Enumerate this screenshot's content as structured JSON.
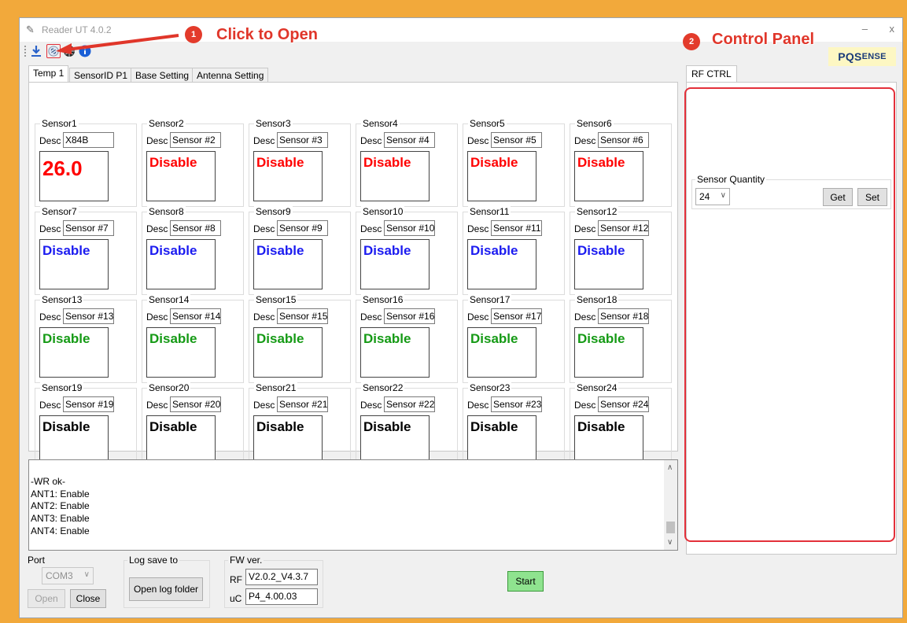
{
  "window": {
    "title": "Reader UT 4.0.2",
    "minimize": "–",
    "close": "x"
  },
  "brand": {
    "first": "PQS",
    "rest": "ENSE"
  },
  "callouts": [
    {
      "num": "1",
      "text": "Click to Open"
    },
    {
      "num": "2",
      "text": "Control Panel"
    }
  ],
  "toolbar": {
    "icons": [
      "download-icon",
      "link-icon",
      "globe-icon",
      "info-icon"
    ]
  },
  "tabs": [
    "Temp 1",
    "SensorID P1",
    "Base Setting",
    "Antenna Setting"
  ],
  "desc_label": "Desc",
  "colors": {
    "row1": "#ff0000",
    "row2": "#1b1bf0",
    "row3": "#159a15",
    "row4": "#000000"
  },
  "sensors": [
    {
      "name": "Sensor1",
      "desc": "X84B",
      "value": "26.0"
    },
    {
      "name": "Sensor2",
      "desc": "Sensor #2",
      "value": "Disable"
    },
    {
      "name": "Sensor3",
      "desc": "Sensor #3",
      "value": "Disable"
    },
    {
      "name": "Sensor4",
      "desc": "Sensor #4",
      "value": "Disable"
    },
    {
      "name": "Sensor5",
      "desc": "Sensor #5",
      "value": "Disable"
    },
    {
      "name": "Sensor6",
      "desc": "Sensor #6",
      "value": "Disable"
    },
    {
      "name": "Sensor7",
      "desc": "Sensor #7",
      "value": "Disable"
    },
    {
      "name": "Sensor8",
      "desc": "Sensor #8",
      "value": "Disable"
    },
    {
      "name": "Sensor9",
      "desc": "Sensor #9",
      "value": "Disable"
    },
    {
      "name": "Sensor10",
      "desc": "Sensor #10",
      "value": "Disable"
    },
    {
      "name": "Sensor11",
      "desc": "Sensor #11",
      "value": "Disable"
    },
    {
      "name": "Sensor12",
      "desc": "Sensor #12",
      "value": "Disable"
    },
    {
      "name": "Sensor13",
      "desc": "Sensor #13",
      "value": "Disable"
    },
    {
      "name": "Sensor14",
      "desc": "Sensor #14",
      "value": "Disable"
    },
    {
      "name": "Sensor15",
      "desc": "Sensor #15",
      "value": "Disable"
    },
    {
      "name": "Sensor16",
      "desc": "Sensor #16",
      "value": "Disable"
    },
    {
      "name": "Sensor17",
      "desc": "Sensor #17",
      "value": "Disable"
    },
    {
      "name": "Sensor18",
      "desc": "Sensor #18",
      "value": "Disable"
    },
    {
      "name": "Sensor19",
      "desc": "Sensor #19",
      "value": "Disable"
    },
    {
      "name": "Sensor20",
      "desc": "Sensor #20",
      "value": "Disable"
    },
    {
      "name": "Sensor21",
      "desc": "Sensor #21",
      "value": "Disable"
    },
    {
      "name": "Sensor22",
      "desc": "Sensor #22",
      "value": "Disable"
    },
    {
      "name": "Sensor23",
      "desc": "Sensor #23",
      "value": "Disable"
    },
    {
      "name": "Sensor24",
      "desc": "Sensor #24",
      "value": "Disable"
    }
  ],
  "log": {
    "lines": [
      "-WR ok-",
      "ANT1: Enable",
      "ANT2: Enable",
      "ANT3: Enable",
      "ANT4: Enable"
    ]
  },
  "port": {
    "title": "Port",
    "value": "COM3",
    "open_label": "Open",
    "close_label": "Close"
  },
  "logsave": {
    "title": "Log save to",
    "button_label": "Open log folder"
  },
  "fw": {
    "title": "FW ver.",
    "rf_label": "RF",
    "rf_value": "V2.0.2_V4.3.7",
    "uc_label": "uC",
    "uc_value": "P4_4.00.03"
  },
  "start_label": "Start",
  "right": {
    "tab": "RF CTRL",
    "sensor_quantity_title": "Sensor Quantity",
    "sensor_quantity_value": "24",
    "get_label": "Get",
    "set_label": "Set"
  }
}
